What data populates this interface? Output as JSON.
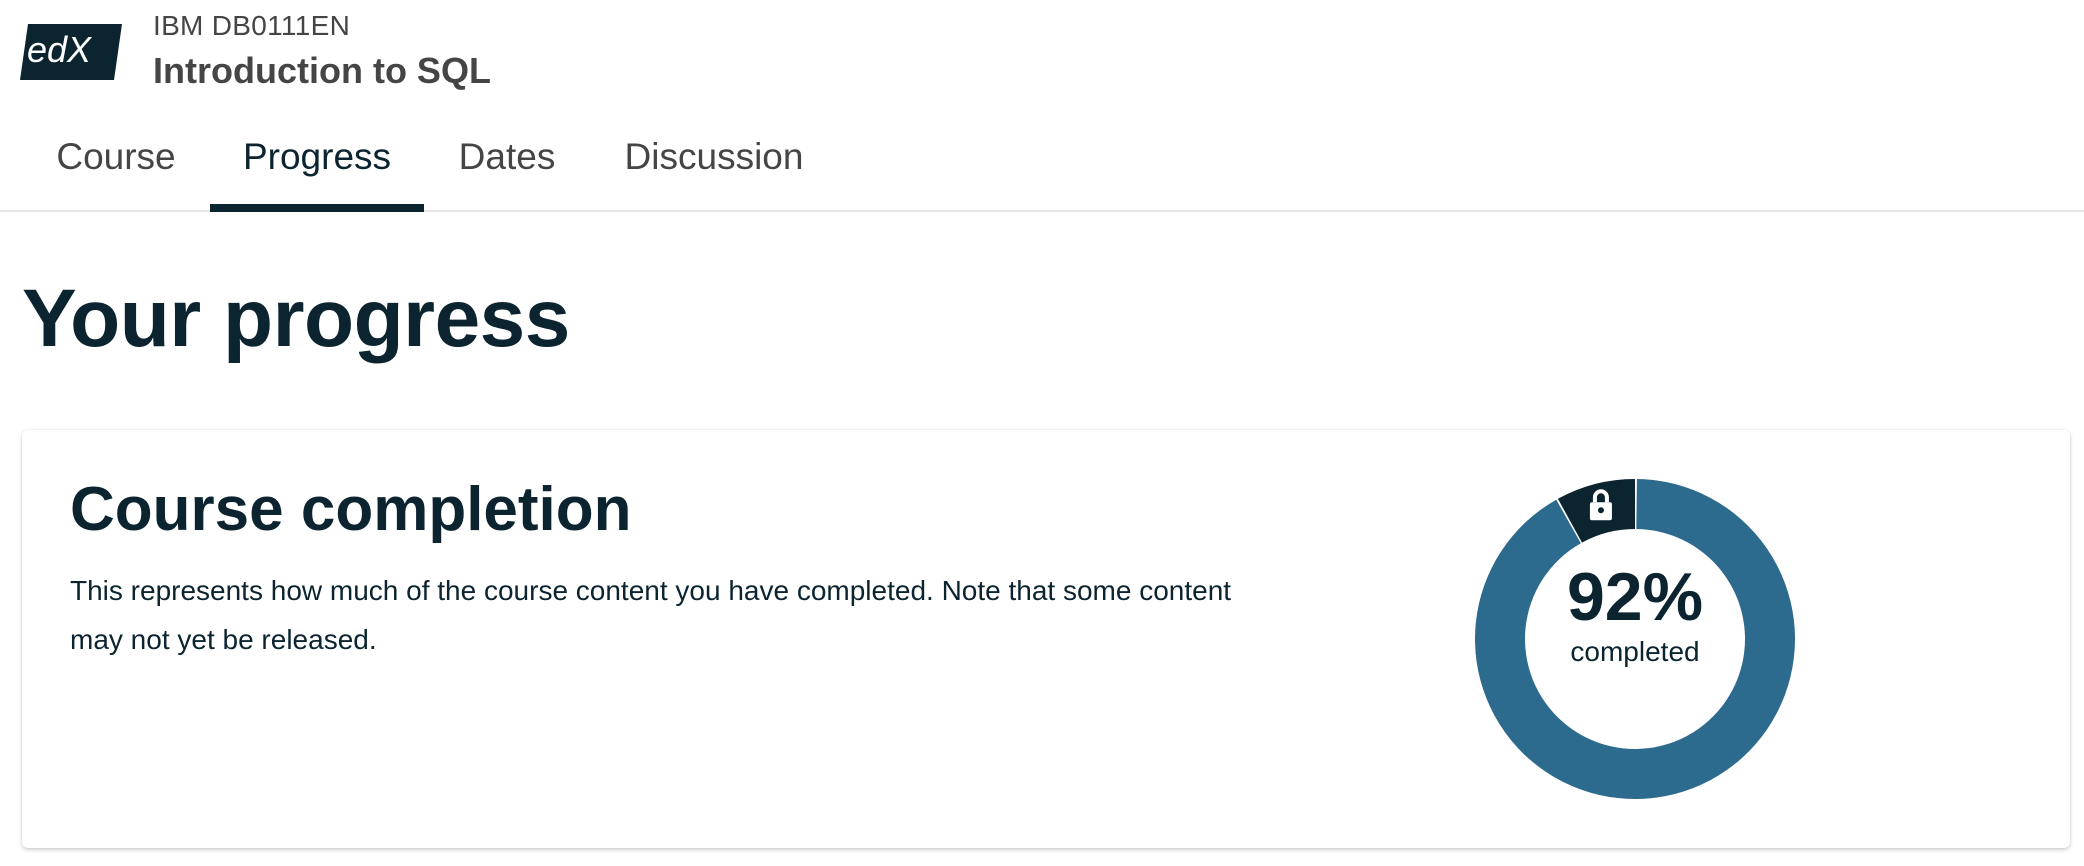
{
  "header": {
    "logo_text": "edX",
    "course_org": "IBM DB0111EN",
    "course_title": "Introduction to SQL"
  },
  "tabs": [
    {
      "label": "Course",
      "active": false
    },
    {
      "label": "Progress",
      "active": true
    },
    {
      "label": "Dates",
      "active": false
    },
    {
      "label": "Discussion",
      "active": false
    }
  ],
  "main": {
    "page_title": "Your progress",
    "completion": {
      "title": "Course completion",
      "description": "This represents how much of the course content you have completed. Note that some content may not yet be released.",
      "percent_label": "92%",
      "percent_caption": "completed",
      "completed_fraction": 0.92,
      "locked_fraction": 0.08,
      "colors": {
        "completed": "#2c6a8e",
        "locked": "#0b2430"
      },
      "locked_icon": "lock-icon"
    }
  },
  "colors": {
    "brand_dark": "#0b2430",
    "tab_text": "#454545",
    "divider": "#e4e6e8"
  }
}
